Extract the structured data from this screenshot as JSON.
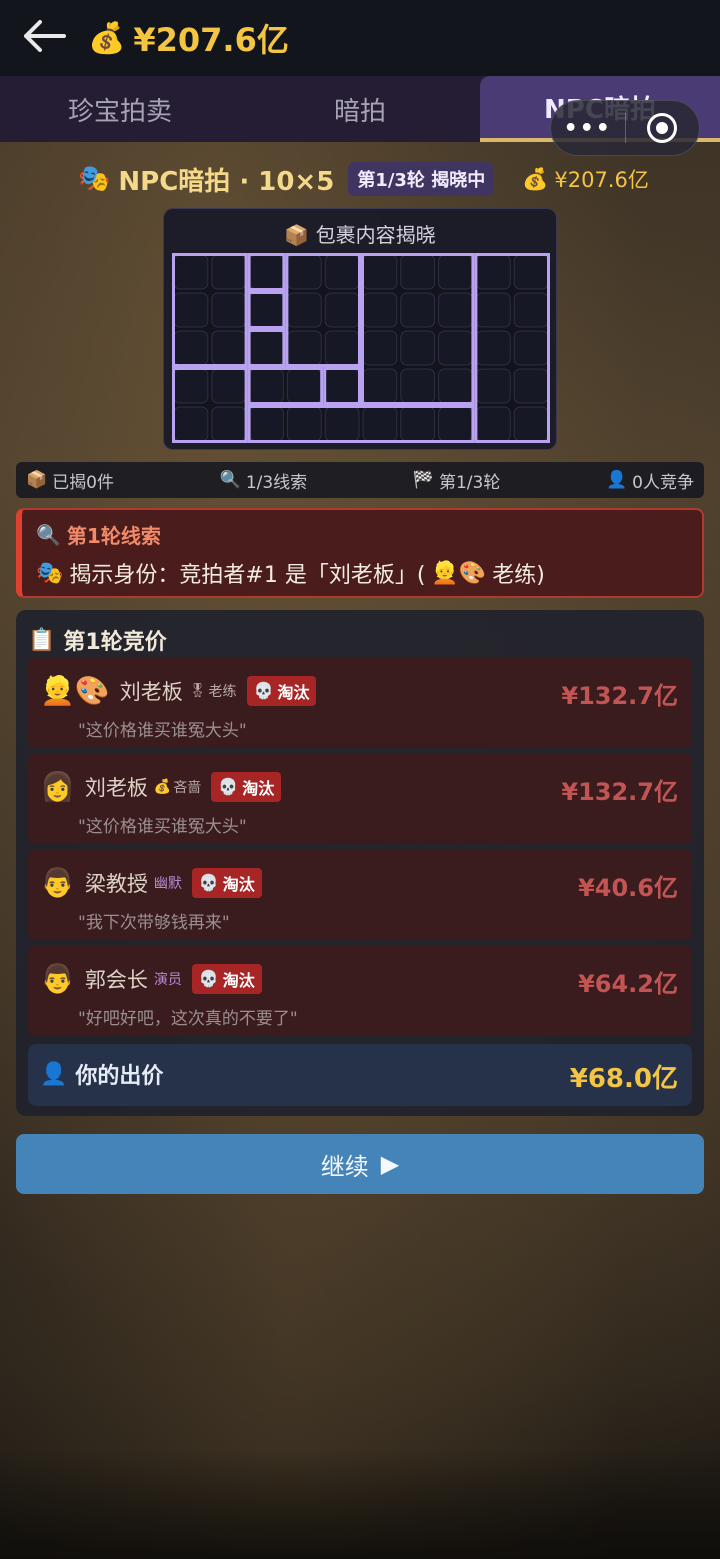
{
  "header": {
    "back_icon": "back-arrow-icon",
    "money_icon": "money-bag-icon",
    "money": "¥207.6亿"
  },
  "tabs": [
    {
      "label": "珍宝拍卖",
      "active": false
    },
    {
      "label": "暗拍",
      "active": false
    },
    {
      "label": "NPC暗拍",
      "active": true
    }
  ],
  "capsule": {
    "more_icon": "more-dots-icon",
    "close_icon": "target-icon"
  },
  "game": {
    "title": "NPC暗拍 · 10×5",
    "round_badge": "第1/3轮 揭晓中",
    "money": "¥207.6亿",
    "grid_title": "包裹内容揭晓",
    "grid_cols": 10,
    "grid_rows": 5
  },
  "stats": [
    {
      "icon": "box-icon",
      "label": "已揭0件"
    },
    {
      "icon": "magnifier-icon",
      "label": "1/3线索"
    },
    {
      "icon": "checkered-flag-icon",
      "label": "第1/3轮"
    },
    {
      "icon": "person-icon",
      "label": "0人竞争"
    }
  ],
  "clue": {
    "title": "第1轮线索",
    "text_prefix": "揭示身份：竞拍者#1 是「刘老板」(",
    "text_suffix": " 老练)"
  },
  "bids": {
    "title": "第1轮竞价",
    "rows": [
      {
        "avatar": "👱🎨",
        "name": "刘老板",
        "trait": "老练",
        "trait_icon": "medal-icon",
        "status": "淘汰",
        "amount": "¥132.7亿",
        "quote": "\"这价格谁买谁冤大头\""
      },
      {
        "avatar": "👩",
        "name": "刘老板",
        "trait": "吝啬",
        "trait_icon": "money-bag-icon",
        "status": "淘汰",
        "amount": "¥132.7亿",
        "quote": "\"这价格谁买谁冤大头\""
      },
      {
        "avatar": "👨",
        "name": "梁教授",
        "trait": "幽默",
        "trait_icon": "",
        "status": "淘汰",
        "amount": "¥40.6亿",
        "quote": "\"我下次带够钱再来\""
      },
      {
        "avatar": "👨",
        "name": "郭会长",
        "trait": "演员",
        "trait_icon": "",
        "status": "淘汰",
        "amount": "¥64.2亿",
        "quote": "\"好吧好吧，这次真的不要了\""
      }
    ],
    "your_bid_label": "你的出价",
    "your_bid_amount": "¥68.0亿"
  },
  "continue_label": "继续",
  "colors": {
    "accent_gold": "#f4c542",
    "danger": "#a82525",
    "primary_button": "#4484b8",
    "grid_line": "#b9a3f0"
  }
}
